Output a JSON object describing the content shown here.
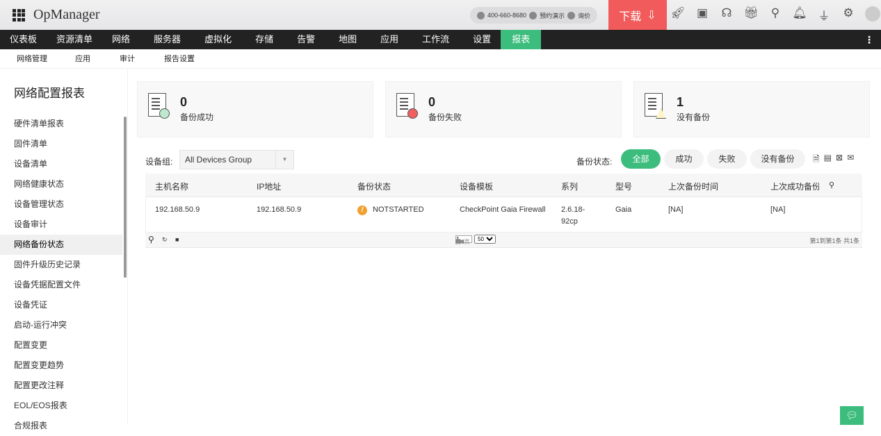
{
  "app": {
    "title": "OpManager"
  },
  "header": {
    "phone": "400-660-8680",
    "demo": "预约演示",
    "price": "询价",
    "download": "下载"
  },
  "nav": [
    "仪表板",
    "资源清单",
    "网络",
    "服务器",
    "虚拟化",
    "存储",
    "告警",
    "地图",
    "应用",
    "工作流",
    "设置",
    "报表"
  ],
  "subnav": [
    "网络管理",
    "应用",
    "审计",
    "报告设置"
  ],
  "sidebar": {
    "title": "网络配置报表",
    "items": [
      "硬件清单报表",
      "固件清单",
      "设备清单",
      "网络健康状态",
      "设备管理状态",
      "设备审计",
      "网络备份状态",
      "固件升级历史记录",
      "设备凭据配置文件",
      "设备凭证",
      "启动-运行冲突",
      "配置变更",
      "配置变更趋势",
      "配置更改注释",
      "EOL/EOS报表",
      "合规报表"
    ],
    "active": "网络备份状态"
  },
  "cards": [
    {
      "num": "0",
      "label": "备份成功"
    },
    {
      "num": "0",
      "label": "备份失败"
    },
    {
      "num": "1",
      "label": "没有备份"
    }
  ],
  "filter": {
    "group_label": "设备组:",
    "group_value": "All Devices Group",
    "status_label": "备份状态:",
    "status": [
      "全部",
      "成功",
      "失败",
      "没有备份"
    ]
  },
  "table": {
    "headers": [
      "主机名称",
      "IP地址",
      "备份状态",
      "设备模板",
      "系列",
      "型号",
      "上次备份时间",
      "上次成功备份"
    ],
    "rows": [
      [
        "192.168.50.9",
        "192.168.50.9",
        "NOTSTARTED",
        "CheckPoint Gaia Firewall",
        "2.6.18-92cp",
        "Gaia",
        "[NA]",
        "[NA]"
      ]
    ]
  },
  "pager": {
    "page_prefix": "第",
    "page": "1",
    "page_suffix": "页",
    "total_pages": "共1页",
    "page_size": "50",
    "summary": "第1到第1条 共1条"
  },
  "colors": {
    "accent": "#3dbd7d",
    "download": "#f15b5b",
    "nav": "#222222"
  }
}
